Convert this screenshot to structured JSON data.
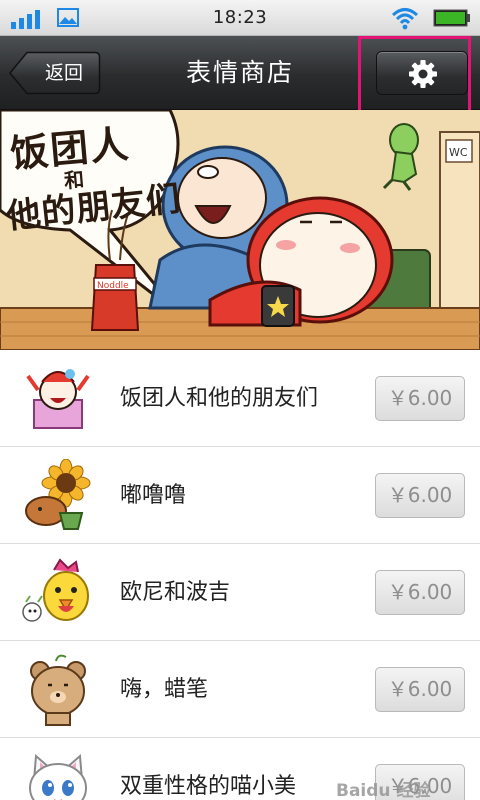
{
  "status_bar": {
    "time": "18:23",
    "icons": [
      "signal-icon",
      "picture-icon",
      "wifi-icon",
      "battery-icon"
    ],
    "signal_color": "#1e88e5",
    "battery_color": "#3bb526"
  },
  "nav_bar": {
    "back_label": "返回",
    "title": "表情商店",
    "settings_icon": "gear-icon"
  },
  "banner": {
    "title": "饭团人",
    "he": "和",
    "subtitle": "他的朋友们",
    "cup_label": "Noddle",
    "door_label": "WC"
  },
  "items": [
    {
      "name": "饭团人和他的朋友们",
      "price": "￥6.00"
    },
    {
      "name": "嘟噜噜",
      "price": "￥6.00"
    },
    {
      "name": "欧尼和波吉",
      "price": "￥6.00"
    },
    {
      "name": "嗨，蜡笔",
      "price": "￥6.00"
    },
    {
      "name": "双重性格的喵小美",
      "price": "￥6.00"
    }
  ],
  "watermark": "Baidu 经验",
  "highlight_color": "#e21476"
}
